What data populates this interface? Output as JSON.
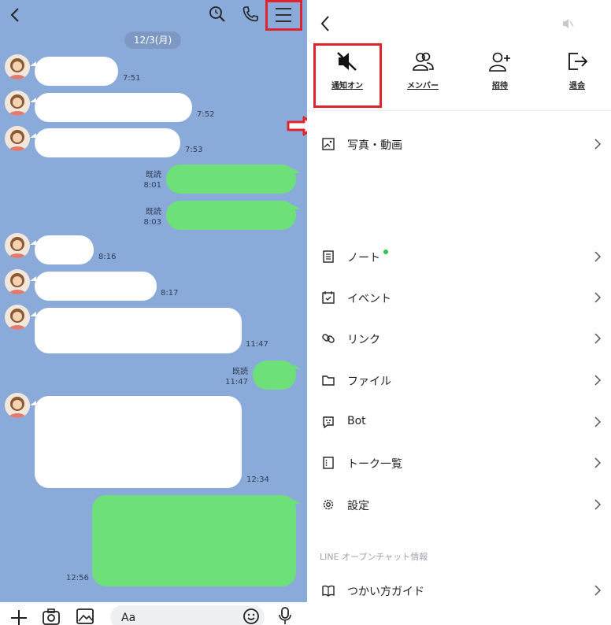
{
  "chat": {
    "date_label": "12/3(月)",
    "messages": [
      {
        "dir": "in",
        "time": "7:51"
      },
      {
        "dir": "in",
        "time": "7:52"
      },
      {
        "dir": "in",
        "time": "7:53"
      },
      {
        "dir": "out",
        "read": "既読",
        "time": "8:01"
      },
      {
        "dir": "out",
        "read": "既読",
        "time": "8:03"
      },
      {
        "dir": "in",
        "time": "8:16"
      },
      {
        "dir": "in",
        "time": "8:17"
      },
      {
        "dir": "in",
        "time": "11:47"
      },
      {
        "dir": "out",
        "read": "既読",
        "time": "11:47"
      },
      {
        "dir": "in",
        "time": "12:34"
      },
      {
        "dir": "out",
        "time": "12:56"
      }
    ],
    "input_placeholder": "Aa",
    "icons": {
      "back": "chevron-left-icon",
      "search": "search-icon",
      "call": "phone-icon",
      "menu": "hamburger-menu-icon",
      "add": "plus-icon",
      "camera": "camera-icon",
      "image": "image-icon",
      "emoji": "emoji-icon",
      "mic": "microphone-icon"
    }
  },
  "menu_panel": {
    "actions": [
      {
        "label": "通知オン",
        "icon": "speaker-mute-icon"
      },
      {
        "label": "メンバー",
        "icon": "members-icon"
      },
      {
        "label": "招待",
        "icon": "add-friend-icon"
      },
      {
        "label": "退会",
        "icon": "exit-icon"
      }
    ],
    "items": [
      {
        "label": "写真・動画",
        "icon": "photo-icon"
      },
      {
        "label": "ノート",
        "icon": "note-icon",
        "new_badge": true
      },
      {
        "label": "イベント",
        "icon": "calendar-icon"
      },
      {
        "label": "リンク",
        "icon": "link-icon"
      },
      {
        "label": "ファイル",
        "icon": "folder-icon"
      },
      {
        "label": "Bot",
        "icon": "bot-icon"
      },
      {
        "label": "トーク一覧",
        "icon": "talk-list-icon"
      },
      {
        "label": "設定",
        "icon": "gear-icon"
      }
    ],
    "section_label": "LINE オープンチャット情報",
    "guide_item": {
      "label": "つかい方ガイド",
      "icon": "book-icon"
    }
  },
  "colors": {
    "chat_background": "#8aaad9",
    "outgoing_bubble": "#6ee07a",
    "incoming_bubble": "#ffffff",
    "highlight": "#e0242d",
    "badge_green": "#2fc44f"
  }
}
